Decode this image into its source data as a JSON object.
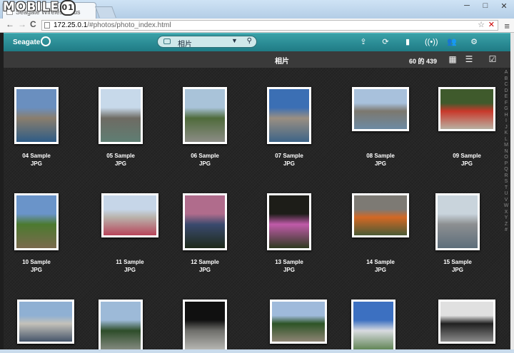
{
  "browser": {
    "tab_title": "Seagate Wireless Plus",
    "watermark": "MOBILE01",
    "url_host": "172.25.0.1",
    "url_path": "/#photos/photo_index.html",
    "nav": {
      "back": "←",
      "forward": "→",
      "reload": "C"
    },
    "window_buttons": {
      "minimize": "─",
      "maximize": "□",
      "close": "✕"
    },
    "menu_icon": "≡",
    "star_icon": "☆",
    "close_icon": "✕"
  },
  "app": {
    "brand": "Seagate",
    "search": {
      "label": "相片",
      "dropdown_icon": "▼",
      "search_icon": "⚲"
    },
    "actions": [
      {
        "name": "upload-icon",
        "glyph": "⇪"
      },
      {
        "name": "refresh-icon",
        "glyph": "⟳"
      },
      {
        "name": "battery-icon",
        "glyph": "▮"
      },
      {
        "name": "wifi-icon",
        "glyph": "((•))"
      },
      {
        "name": "users-icon",
        "glyph": "👥"
      },
      {
        "name": "settings-icon",
        "glyph": "⚙"
      }
    ],
    "subbar": {
      "title": "相片",
      "count": "60 的 439",
      "grid_view": "▦",
      "list_view": "☰",
      "select": "☑"
    }
  },
  "alphabet": [
    "A",
    "B",
    "C",
    "D",
    "E",
    "F",
    "G",
    "H",
    "I",
    "J",
    "K",
    "L",
    "M",
    "N",
    "O",
    "P",
    "Q",
    "R",
    "S",
    "T",
    "U",
    "V",
    "W",
    "X",
    "Y",
    "Z",
    "#"
  ],
  "photos": [
    {
      "name": "04 Sample",
      "type": "JPG",
      "orient": "portrait",
      "colors": [
        "#6a8fbf",
        "#8a7e6d",
        "#2e5c86"
      ]
    },
    {
      "name": "05 Sample",
      "type": "JPG",
      "orient": "portrait",
      "colors": [
        "#c7d9ea",
        "#6e6b63",
        "#5f7e73"
      ]
    },
    {
      "name": "06 Sample",
      "type": "JPG",
      "orient": "portrait",
      "colors": [
        "#a9c3d9",
        "#4f6b3b",
        "#8c8c86"
      ]
    },
    {
      "name": "07 Sample",
      "type": "JPG",
      "orient": "portrait",
      "colors": [
        "#3b6fb4",
        "#9a8f82",
        "#3d6487"
      ]
    },
    {
      "name": "08 Sample",
      "type": "JPG",
      "orient": "landscape",
      "colors": [
        "#a8c1dc",
        "#7c786f",
        "#6d8aa3"
      ]
    },
    {
      "name": "09 Sample",
      "type": "JPG",
      "orient": "landscape",
      "colors": [
        "#3f5a2c",
        "#c8392b",
        "#b9b0a2"
      ]
    },
    {
      "name": "10 Sample",
      "type": "JPG",
      "orient": "portrait",
      "colors": [
        "#6a94c9",
        "#4c7a2f",
        "#7b6a4e"
      ]
    },
    {
      "name": "11 Sample",
      "type": "JPG",
      "orient": "landscape",
      "colors": [
        "#c6d6e8",
        "#b9b2ab",
        "#b8455a"
      ]
    },
    {
      "name": "12 Sample",
      "type": "JPG",
      "orient": "portrait",
      "colors": [
        "#b06c8c",
        "#3a4a6e",
        "#1e2a1a"
      ]
    },
    {
      "name": "13 Sample",
      "type": "JPG",
      "orient": "portrait",
      "colors": [
        "#1d1d18",
        "#c05ba9",
        "#2f3a20"
      ]
    },
    {
      "name": "14 Sample",
      "type": "JPG",
      "orient": "landscape",
      "colors": [
        "#7d7a74",
        "#d36824",
        "#4b5b35"
      ]
    },
    {
      "name": "15 Sample",
      "type": "JPG",
      "orient": "portrait",
      "colors": [
        "#c9d4dc",
        "#8c8f91",
        "#5d6e7b"
      ]
    },
    {
      "name": "",
      "type": "",
      "orient": "landscape",
      "colors": [
        "#8fb0d3",
        "#c4c1b9",
        "#46556a"
      ]
    },
    {
      "name": "",
      "type": "",
      "orient": "portrait",
      "colors": [
        "#9dbad8",
        "#2e4d2a",
        "#9a9a96"
      ]
    },
    {
      "name": "",
      "type": "",
      "orient": "portrait",
      "colors": [
        "#101010",
        "#6f6f6b",
        "#c8c8c4"
      ]
    },
    {
      "name": "",
      "type": "",
      "orient": "landscape",
      "colors": [
        "#9fbadb",
        "#2d5426",
        "#8e8474"
      ]
    },
    {
      "name": "",
      "type": "",
      "orient": "portrait",
      "colors": [
        "#3c70c1",
        "#d8dbe0",
        "#446f33"
      ]
    },
    {
      "name": "",
      "type": "",
      "orient": "landscape",
      "colors": [
        "#e0e0e0",
        "#202020",
        "#8a8a8a"
      ]
    }
  ]
}
